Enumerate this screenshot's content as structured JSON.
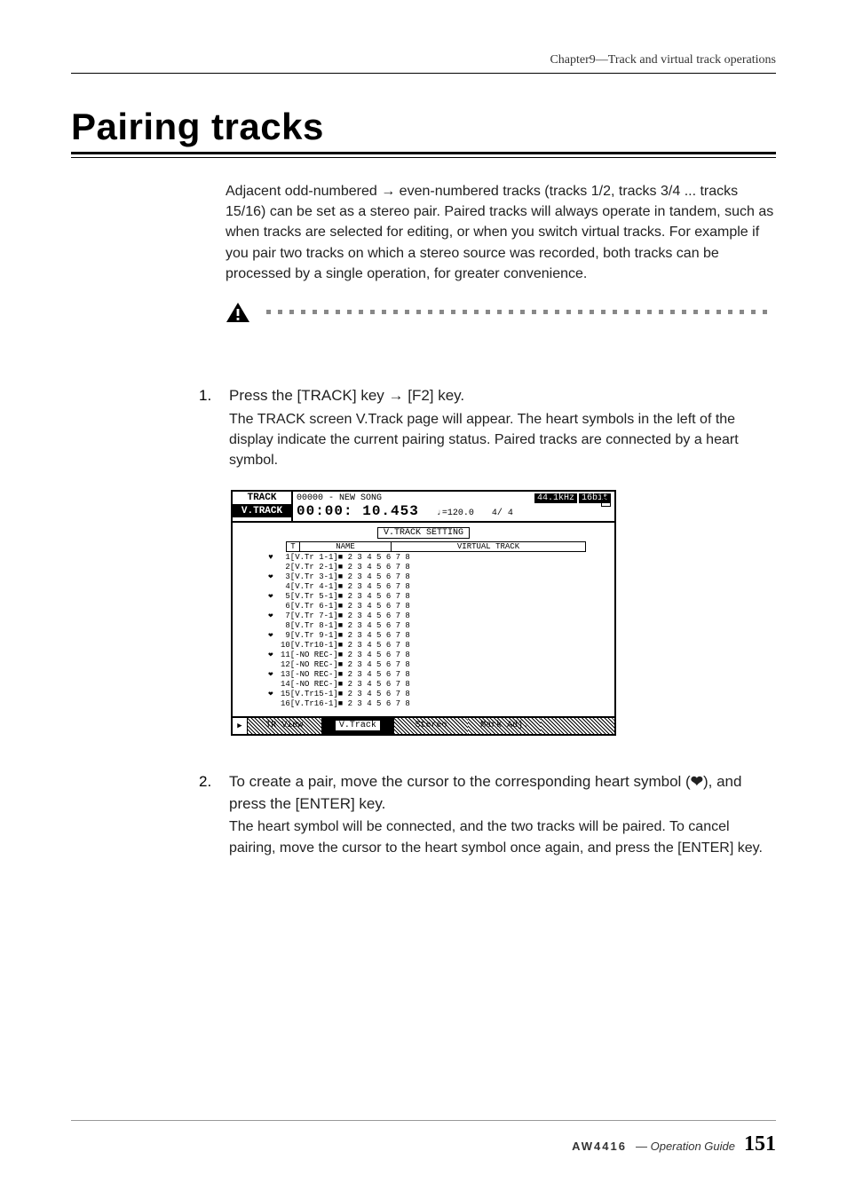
{
  "chapter": "Chapter9—Track and virtual track operations",
  "title": "Pairing tracks",
  "intro": "Adjacent odd-numbered → even-numbered tracks (tracks 1/2, tracks 3/4 ... tracks 15/16) can be set as a stereo pair. Paired tracks will always operate in tandem, such as when tracks are selected for editing, or when you switch virtual tracks. For example if you pair two tracks on which a stereo source was recorded, both tracks can be processed by a single operation, for greater convenience.",
  "steps": [
    {
      "num": "1.",
      "lead": "Press the [TRACK] key → [F2] key.",
      "desc": "The TRACK screen V.Track page will appear. The heart symbols in the left of the display indicate the current pairing status. Paired tracks are connected by a heart symbol."
    },
    {
      "num": "2.",
      "lead_before": "To create a pair, move the cursor to the corresponding heart symbol (",
      "lead_after": "), and press the [ENTER] key.",
      "desc": "The heart symbol will be connected, and the two tracks will be paired. To cancel pairing, move the cursor to the heart symbol once again, and press the [ENTER] key."
    }
  ],
  "lcd": {
    "tab_selected": "TRACK",
    "tab_other": "V.TRACK",
    "song_id": "00000 - NEW SONG",
    "sr": "44.1kHz",
    "bits": "16bit",
    "time": "00:00: 10.453",
    "tempo": "♩=120.0",
    "sig": "4/ 4",
    "m_icon": "M",
    "section_title": "V.TRACK SETTING",
    "col_t": "T",
    "col_name": "NAME",
    "col_vt": "VIRTUAL TRACK",
    "rows": [
      {
        "heart": "♥",
        "text": " 1[V.Tr 1-1]■ 2 3 4 5 6 7 8"
      },
      {
        "heart": "",
        "text": " 2[V.Tr 2-1]■ 2 3 4 5 6 7 8"
      },
      {
        "heart": "❤",
        "text": " 3[V.Tr 3-1]■ 2 3 4 5 6 7 8"
      },
      {
        "heart": "",
        "text": " 4[V.Tr 4-1]■ 2 3 4 5 6 7 8"
      },
      {
        "heart": "❤",
        "text": " 5[V.Tr 5-1]■ 2 3 4 5 6 7 8"
      },
      {
        "heart": "",
        "text": " 6[V.Tr 6-1]■ 2 3 4 5 6 7 8"
      },
      {
        "heart": "❤",
        "text": " 7[V.Tr 7-1]■ 2 3 4 5 6 7 8"
      },
      {
        "heart": "",
        "text": " 8[V.Tr 8-1]■ 2 3 4 5 6 7 8"
      },
      {
        "heart": "❤",
        "text": " 9[V.Tr 9-1]■ 2 3 4 5 6 7 8"
      },
      {
        "heart": "",
        "text": "10[V.Tr10-1]■ 2 3 4 5 6 7 8"
      },
      {
        "heart": "❤",
        "text": "11[-NO REC-]■ 2 3 4 5 6 7 8"
      },
      {
        "heart": "",
        "text": "12[-NO REC-]■ 2 3 4 5 6 7 8"
      },
      {
        "heart": "❤",
        "text": "13[-NO REC-]■ 2 3 4 5 6 7 8"
      },
      {
        "heart": "",
        "text": "14[-NO REC-]■ 2 3 4 5 6 7 8"
      },
      {
        "heart": "❤",
        "text": "15[V.Tr15-1]■ 2 3 4 5 6 7 8"
      },
      {
        "heart": "",
        "text": "16[V.Tr16-1]■ 2 3 4 5 6 7 8"
      }
    ],
    "bottom_tabs": {
      "play": "▶",
      "t1": "TR View",
      "t2": "V.Track",
      "t3": "Stereo",
      "t4": "Mark Adj.",
      "t5": ""
    }
  },
  "heart_glyph": "❤",
  "footer": {
    "model": "AW4416",
    "guide": "— Operation Guide",
    "page": "151"
  }
}
